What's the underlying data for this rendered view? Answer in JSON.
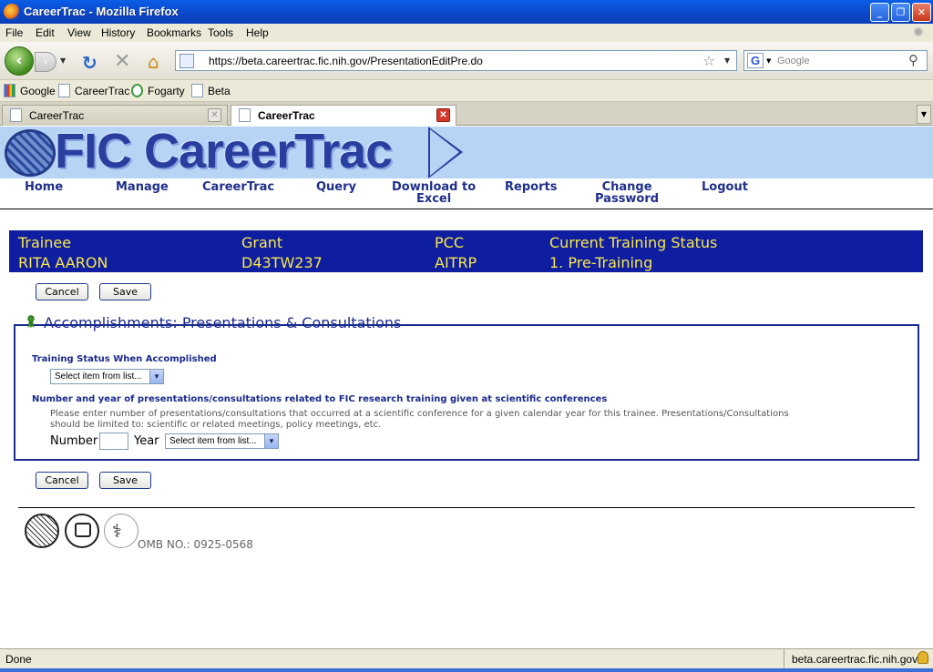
{
  "window": {
    "title": "CareerTrac - Mozilla Firefox"
  },
  "menu": [
    "File",
    "Edit",
    "View",
    "History",
    "Bookmarks",
    "Tools",
    "Help"
  ],
  "navbar": {
    "url": "https://beta.careertrac.fic.nih.gov/PresentationEditPre.do",
    "search_placeholder": "Google"
  },
  "bookmarks": [
    "Google",
    "CareerTrac",
    "Fogarty",
    "Beta"
  ],
  "tabs": [
    {
      "label": "CareerTrac",
      "active": false
    },
    {
      "label": "CareerTrac",
      "active": true
    }
  ],
  "banner": {
    "logo_text": "FIC CareerTrac"
  },
  "topnav": {
    "home": "Home",
    "manage": "Manage",
    "careertrac": "CareerTrac",
    "query": "Query",
    "download_line1": "Download to",
    "download_line2": "Excel",
    "reports": "Reports",
    "change_line1": "Change",
    "change_line2": "Password",
    "logout": "Logout"
  },
  "trainee": {
    "trainee_label": "Trainee",
    "trainee_value": "RITA AARON",
    "grant_label": "Grant",
    "grant_value": "D43TW237",
    "pcc_label": "PCC",
    "pcc_value": "AITRP",
    "status_label": "Current Training Status",
    "status_value": "1. Pre-Training"
  },
  "buttons": {
    "cancel": "Cancel",
    "save": "Save"
  },
  "form": {
    "legend": "Accomplishments: Presentations & Consultations",
    "training_status_label": "Training Status When Accomplished",
    "select_placeholder": "Select item from list...",
    "number_year_label": "Number and year of presentations/consultations related to FIC research training given at scientific conferences",
    "help_line1": "Please enter number of presentations/consultations that occurred at a scientific conference for a given calendar year for this trainee. Presentations/Consultations",
    "help_line2": "should be limited to: scientific or related meetings, policy meetings, etc.",
    "number_label": "Number",
    "year_label": "Year",
    "number_value": ""
  },
  "footer": {
    "omb": "OMB NO.: 0925-0568"
  },
  "status": {
    "text": "Done",
    "domain": "beta.careertrac.fic.nih.gov"
  }
}
